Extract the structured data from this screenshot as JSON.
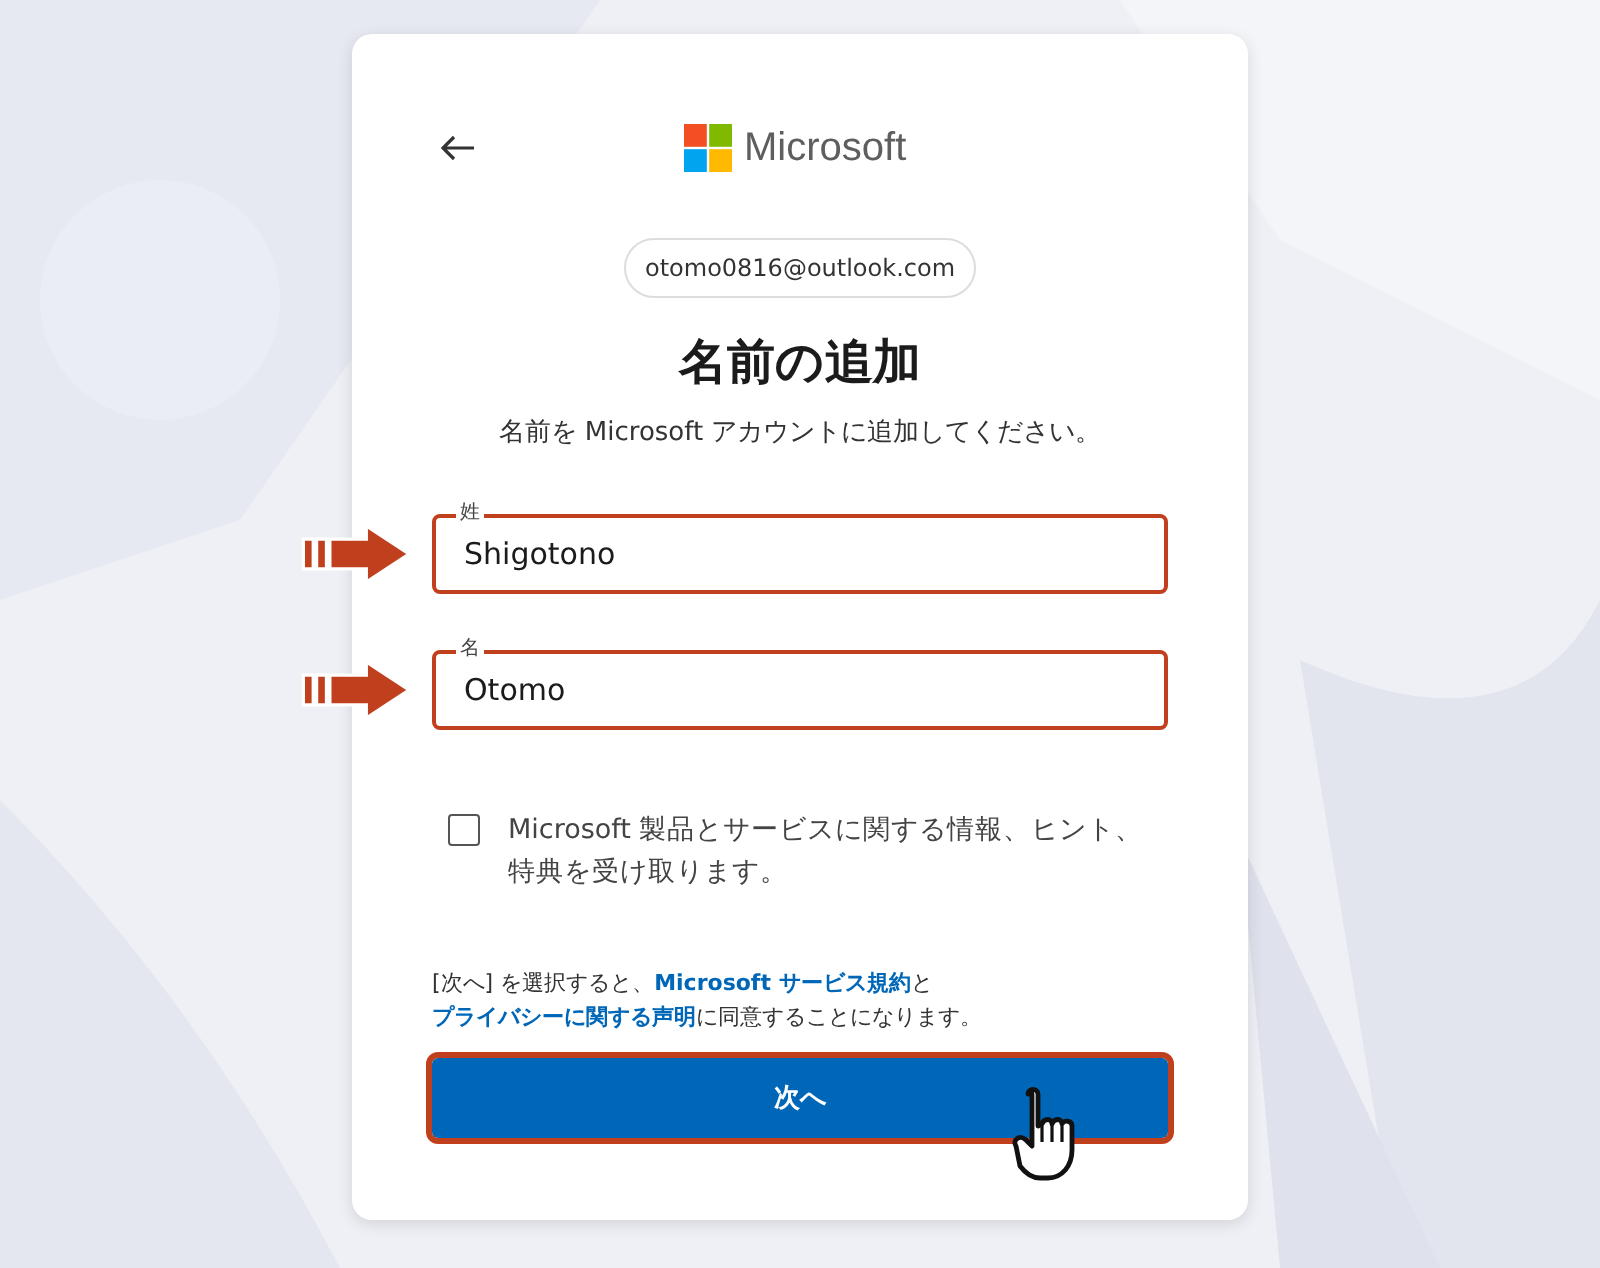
{
  "brand": {
    "name": "Microsoft"
  },
  "account": {
    "email": "otomo0816@outlook.com"
  },
  "heading": "名前の追加",
  "subtitle": "名前を Microsoft アカウントに追加してください。",
  "fields": [
    {
      "label": "姓",
      "value": "Shigotono",
      "highlighted": true
    },
    {
      "label": "名",
      "value": "Otomo",
      "highlighted": true
    }
  ],
  "opt_in": {
    "label": "Microsoft 製品とサービスに関する情報、ヒント、特典を受け取ります。",
    "checked": false
  },
  "consent": [
    {
      "kind": "text",
      "text": "[次へ] を選択すると、"
    },
    {
      "kind": "link",
      "text": "Microsoft サービス規約"
    },
    {
      "kind": "text",
      "text": "と"
    },
    {
      "kind": "link",
      "text": "プライバシーに関する声明"
    },
    {
      "kind": "text",
      "text": "に同意することになります。"
    }
  ],
  "next_button": {
    "label": "次へ",
    "highlighted": true,
    "pointer": true
  }
}
